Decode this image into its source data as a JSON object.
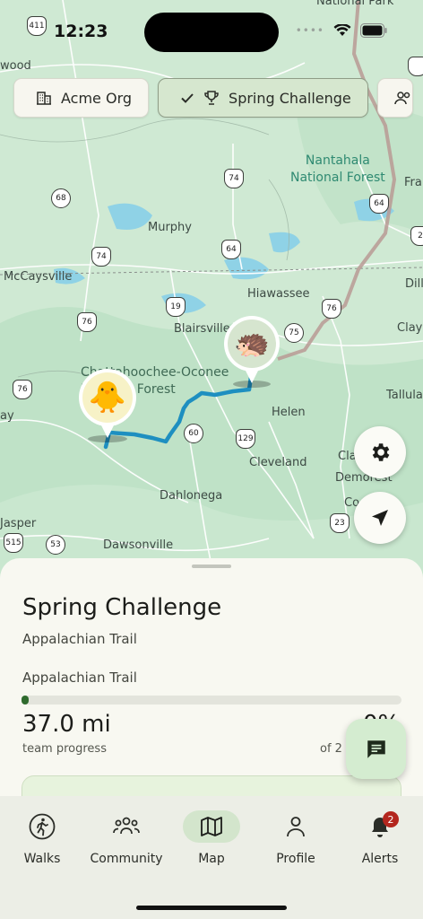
{
  "status": {
    "time": "12:23"
  },
  "chips": [
    {
      "label": "Acme Org",
      "icon": "building-icon",
      "selected": false
    },
    {
      "label": "Spring Challenge",
      "icon": "trophy-icon",
      "selected": true
    },
    {
      "label": "",
      "icon": "group-icon",
      "selected": false
    }
  ],
  "map": {
    "places": {
      "nantahala": "Nantahala\nNational Forest",
      "murphy": "Murphy",
      "mccaysville": "McCaysville",
      "hiawassee": "Hiawassee",
      "blairsville": "Blairsville",
      "chattahoochee": "Chattahoochee-Oconee\nNational Forest",
      "helen": "Helen",
      "cleveland": "Cleveland",
      "dahlonega": "Dahlonega",
      "dawsonville": "Dawsonville",
      "jasper": "Jasper",
      "wood": "wood",
      "clay": "Clay",
      "dill": "Dill",
      "fra": "Fra",
      "tallulah": "Tallulah",
      "ay": "ay",
      "demorest": "Demorest",
      "cla": "Cla",
      "co": "Co",
      "national_park": "National Park"
    },
    "route_shields": [
      "411",
      "68",
      "74",
      "74",
      "64",
      "64",
      "19",
      "76",
      "76",
      "76",
      "75",
      "60",
      "129",
      "515",
      "53",
      "23",
      "2"
    ],
    "avatars": [
      {
        "name": "chick-avatar",
        "emoji": "🐥"
      },
      {
        "name": "hedgehog-avatar",
        "emoji": "🦔"
      }
    ]
  },
  "buttons": {
    "settings": "settings-icon",
    "locate": "navigation-arrow-icon"
  },
  "sheet": {
    "title": "Spring Challenge",
    "subtitle": "Appalachian Trail",
    "trail_label": "Appalachian Trail",
    "progress_fraction": 0.017,
    "distance": "37.0 mi",
    "distance_caption": "team progress",
    "percent": "0%",
    "of_caption": "of 2"
  },
  "nav": {
    "items": [
      {
        "label": "Walks",
        "icon": "walking-person-icon",
        "active": false
      },
      {
        "label": "Community",
        "icon": "people-icon",
        "active": false
      },
      {
        "label": "Map",
        "icon": "map-icon",
        "active": true
      },
      {
        "label": "Profile",
        "icon": "person-icon",
        "active": false
      },
      {
        "label": "Alerts",
        "icon": "bell-icon",
        "active": false,
        "badge": "2"
      }
    ]
  },
  "colors": {
    "accent": "#2f6b2e",
    "route": "#1e8fc0",
    "border_line": "#b99a94"
  }
}
